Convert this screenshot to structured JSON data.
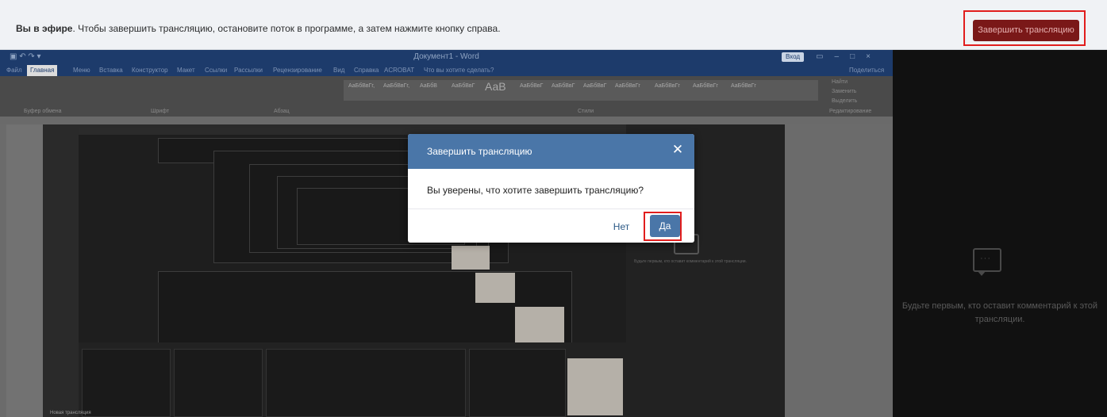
{
  "topbar": {
    "live_label": "Вы в эфире",
    "message": ". Чтобы завершить трансляцию, остановите поток в программе, а затем нажмите кнопку справа.",
    "end_button": "Завершить трансляцию"
  },
  "word": {
    "title": "Документ1 - Word",
    "login": "Вход",
    "tabs": [
      "Файл",
      "Главная",
      "Меню",
      "Вставка",
      "Конструктор",
      "Макет",
      "Ссылки",
      "Рассылки",
      "Рецензирование",
      "Вид",
      "Справка",
      "ACROBAT",
      "Что вы хотите сделать?"
    ],
    "share": "Поделиться",
    "groups": [
      "Буфер обмена",
      "Шрифт",
      "Абзац",
      "Стили",
      "Редактирование"
    ],
    "style_samples": [
      "АаБбВвГг,",
      "АаБбВвГг,",
      "АаБбВ",
      "АаБбВвГ",
      "АаВ",
      "АаБбВвГ",
      "АаБбВвГ",
      "АаБбВвГ",
      "АаБбВвГг",
      "АаБбВвГг",
      "АаБбВвГг",
      "АаБбВвГг"
    ],
    "editing": [
      "Найти",
      "Заменить",
      "Выделить"
    ]
  },
  "stream_preview": {
    "chat_hint": "Будьте первым, кто оставит комментарий к этой трансляции.",
    "bottom_label": "Новая трансляция"
  },
  "modal": {
    "title": "Завершить трансляцию",
    "body": "Вы уверены, что хотите завершить трансляцию?",
    "no_label": "Нет",
    "yes_label": "Да",
    "close_icon": "close-icon"
  },
  "chat": {
    "icon": "comment-icon",
    "hint": "Будьте первым, кто оставит комментарий к этой трансляции."
  },
  "colors": {
    "accent": "#4a76a8",
    "highlight": "#e11d1d",
    "end_button_bg": "#7a1818"
  }
}
